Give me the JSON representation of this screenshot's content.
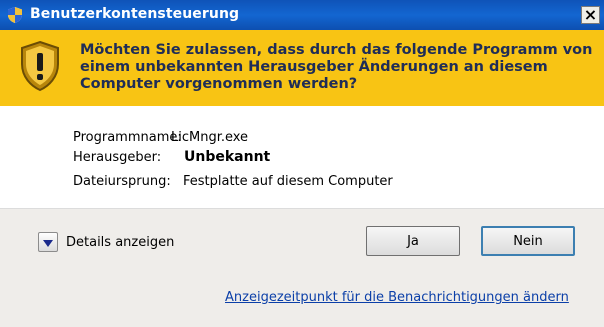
{
  "window": {
    "title": "Benutzerkontensteuerung",
    "close_glyph": "×"
  },
  "banner": {
    "message": "Möchten Sie zulassen, dass durch das folgende Programm von einem unbekannten Herausgeber Änderungen an diesem Computer vorgenommen werden?",
    "icon": "warning-shield-icon",
    "background": "#f8c414",
    "text_color": "#1f2d57"
  },
  "details": {
    "program_name_label": "Programmname:",
    "program_name_value": "LicMngr.exe",
    "publisher_label": "Herausgeber:",
    "publisher_value": "Unbekannt",
    "origin_label": "Dateiursprung:",
    "origin_value": "Festplatte auf diesem Computer"
  },
  "footer": {
    "details_toggle_label": "Details anzeigen",
    "yes_label": "Ja",
    "no_label": "Nein",
    "notification_link": "Anzeigezeitpunkt für die Benachrichtigungen ändern",
    "background": "#efedea",
    "link_color": "#0b3fa8"
  },
  "colors": {
    "titlebar": "#1366d1",
    "default_button_border": "#3c7fb1"
  }
}
